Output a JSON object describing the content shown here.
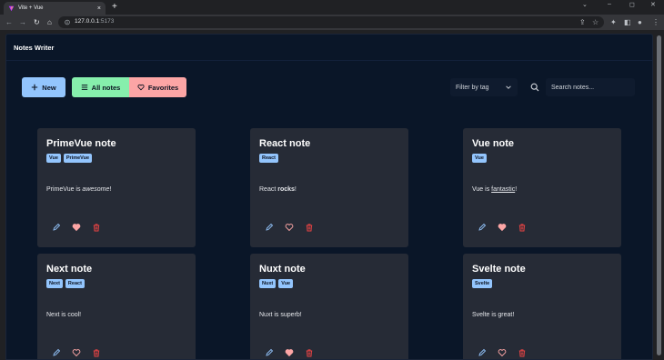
{
  "browser": {
    "tab_title": "Vite + Vue",
    "tab_close": "×",
    "new_tab": "+",
    "window_controls": [
      "–",
      "◻",
      "✕"
    ],
    "url_host": "127.0.0.1",
    "url_port": ":5173",
    "nav_icons": [
      "back-icon",
      "forward-icon",
      "reload-icon",
      "home-icon"
    ],
    "right_icons": [
      "share-icon",
      "bookmark-star-icon",
      "extensions-icon",
      "sidebar-icon",
      "profile-icon",
      "menu-icon"
    ]
  },
  "app": {
    "title": "Notes Writer",
    "new_label": "New",
    "all_notes_label": "All notes",
    "favorites_label": "Favorites",
    "filter_label": "Filter by tag",
    "search_placeholder": "Search notes..."
  },
  "notes": [
    {
      "title": "PrimeVue note",
      "tags": [
        "Vue",
        "PrimeVue"
      ],
      "body": {
        "prefix": "PrimeVue is ",
        "styled": "awesome",
        "style": "italic",
        "suffix": "!"
      },
      "favorite": true
    },
    {
      "title": "React note",
      "tags": [
        "React"
      ],
      "body": {
        "prefix": "React ",
        "styled": "rocks",
        "style": "bold",
        "suffix": "!"
      },
      "favorite": false
    },
    {
      "title": "Vue note",
      "tags": [
        "Vue"
      ],
      "body": {
        "prefix": "Vue is ",
        "styled": "fantastic",
        "style": "underline",
        "suffix": "!"
      },
      "favorite": true
    },
    {
      "title": "Next note",
      "tags": [
        "Next",
        "React"
      ],
      "body": {
        "prefix": "Next is cool!",
        "styled": "",
        "style": "none",
        "suffix": ""
      },
      "favorite": false
    },
    {
      "title": "Nuxt note",
      "tags": [
        "Nuxt",
        "Vue"
      ],
      "body": {
        "prefix": "Nuxt is superb!",
        "styled": "",
        "style": "none",
        "suffix": ""
      },
      "favorite": true
    },
    {
      "title": "Svelte note",
      "tags": [
        "Svelte"
      ],
      "body": {
        "prefix": "Svelte is great!",
        "styled": "",
        "style": "none",
        "suffix": ""
      },
      "favorite": false
    }
  ],
  "colors": {
    "accent_blue": "#93c5fd",
    "accent_green": "#86efac",
    "accent_red": "#fca5a5",
    "delete_red": "#ef4444",
    "card_bg": "#262b36",
    "page_bg": "#0a1628"
  }
}
